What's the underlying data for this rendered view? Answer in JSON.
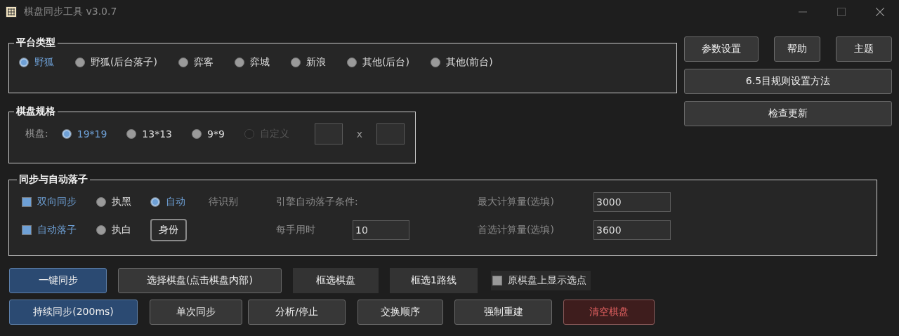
{
  "window": {
    "title": "棋盘同步工具 v3.0.7"
  },
  "platform": {
    "title": "平台类型",
    "options": [
      {
        "label": "野狐",
        "selected": true
      },
      {
        "label": "野狐(后台落子)",
        "selected": false
      },
      {
        "label": "弈客",
        "selected": false
      },
      {
        "label": "弈城",
        "selected": false
      },
      {
        "label": "新浪",
        "selected": false
      },
      {
        "label": "其他(后台)",
        "selected": false
      },
      {
        "label": "其他(前台)",
        "selected": false
      }
    ]
  },
  "board_size": {
    "title": "棋盘规格",
    "label": "棋盘:",
    "options": [
      {
        "label": "19*19",
        "selected": true,
        "disabled": false
      },
      {
        "label": "13*13",
        "selected": false,
        "disabled": false
      },
      {
        "label": "9*9",
        "selected": false,
        "disabled": false
      },
      {
        "label": "自定义",
        "selected": false,
        "disabled": true
      }
    ],
    "separator": "x"
  },
  "top_buttons": [
    "参数设置",
    "帮助",
    "主题"
  ],
  "wide_buttons": [
    "6.5目规则设置方法",
    "检查更新"
  ],
  "sync": {
    "title": "同步与自动落子",
    "two_way": {
      "label": "双向同步",
      "checked": true
    },
    "auto_play": {
      "label": "自动落子",
      "checked": true
    },
    "sides": [
      {
        "label": "执黑",
        "selected": false
      },
      {
        "label": "自动",
        "selected": true
      },
      {
        "label": "执白",
        "selected": false
      }
    ],
    "status": "待识别",
    "identity_button": "身份",
    "engine_label": "引擎自动落子条件:",
    "time_label": "每手用时",
    "time_value": "10",
    "max_label": "最大计算量(选填)",
    "max_value": "3000",
    "pref_label": "首选计算量(选填)",
    "pref_value": "3600"
  },
  "actions_row_1": [
    {
      "label": "一键同步",
      "kind": "primary"
    },
    {
      "label": "选择棋盘(点击棋盘内部)",
      "kind": "normal"
    },
    {
      "label": "框选棋盘",
      "kind": "flat"
    },
    {
      "label": "框选1路线",
      "kind": "flat"
    }
  ],
  "show_points": {
    "label": "原棋盘上显示选点",
    "checked": false
  },
  "actions_row_2": [
    {
      "label": "持续同步(200ms)",
      "kind": "primary"
    },
    {
      "label": "单次同步",
      "kind": "normal"
    },
    {
      "label": "分析/停止",
      "kind": "normal"
    },
    {
      "label": "交换顺序",
      "kind": "normal"
    },
    {
      "label": "强制重建",
      "kind": "normal"
    },
    {
      "label": "清空棋盘",
      "kind": "danger"
    }
  ]
}
